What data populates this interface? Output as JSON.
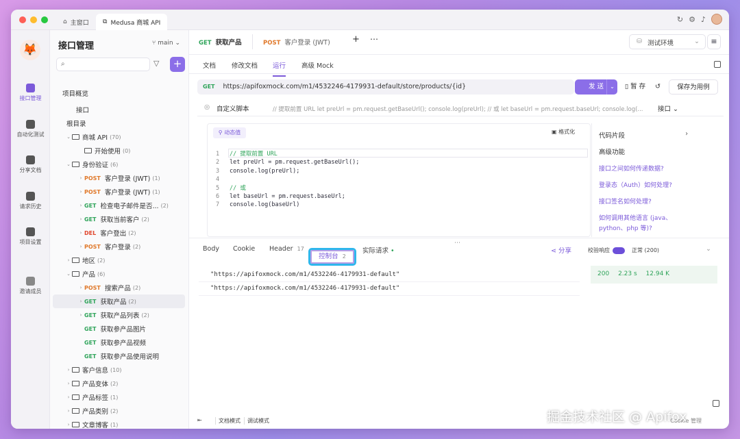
{
  "titlebar": {
    "home_tab": "主窗口",
    "project_tab": "Medusa 商城 API"
  },
  "rail": [
    {
      "label": "接口管理"
    },
    {
      "label": "自动化测试"
    },
    {
      "label": "分享文档"
    },
    {
      "label": "请求历史"
    },
    {
      "label": "项目设置"
    },
    {
      "label": "邀请成员"
    }
  ],
  "tree": {
    "title": "接口管理",
    "branch": "main",
    "items": [
      {
        "label": "项目概览"
      },
      {
        "label": "接口"
      },
      {
        "label": "根目录"
      },
      {
        "label": "商城 API",
        "count": "(70)"
      },
      {
        "label": "开始使用",
        "count": "(0)"
      },
      {
        "label": "身份验证",
        "count": "(6)"
      },
      {
        "method": "POST",
        "label": "客户登录 (JWT)",
        "count": "(1)"
      },
      {
        "method": "POST",
        "label": "客户登录 (JWT)",
        "count": "(1)"
      },
      {
        "method": "GET",
        "label": "检查电子邮件是否...",
        "count": "(2)"
      },
      {
        "method": "GET",
        "label": "获取当前客户",
        "count": "(2)"
      },
      {
        "method": "DEL",
        "label": "客户登出",
        "count": "(2)"
      },
      {
        "method": "POST",
        "label": "客户登录",
        "count": "(2)"
      },
      {
        "label": "地区",
        "count": "(2)"
      },
      {
        "label": "产品",
        "count": "(6)"
      },
      {
        "method": "POST",
        "label": "搜索产品",
        "count": "(2)"
      },
      {
        "method": "GET",
        "label": "获取产品",
        "count": "(2)"
      },
      {
        "method": "GET",
        "label": "获取产品列表",
        "count": "(2)"
      },
      {
        "method": "GET",
        "label": "获取参产品图片",
        "count": ""
      },
      {
        "method": "GET",
        "label": "获取参产品视频",
        "count": ""
      },
      {
        "method": "GET",
        "label": "获取参产品使用说明",
        "count": ""
      },
      {
        "label": "客户信息",
        "count": "(10)"
      },
      {
        "label": "产品变体",
        "count": "(2)"
      },
      {
        "label": "产品标签",
        "count": "(1)"
      },
      {
        "label": "产品类别",
        "count": "(2)"
      },
      {
        "label": "文章博客",
        "count": "(1)"
      }
    ]
  },
  "filetabs": [
    {
      "method": "GET",
      "label": "获取产品"
    },
    {
      "method": "POST",
      "label": "客户登录 (JWT)"
    }
  ],
  "env": "测试环境",
  "subtabs": [
    "文档",
    "修改文档",
    "运行",
    "高级 Mock"
  ],
  "request": {
    "method": "GET",
    "url": "https://apifoxmock.com/m1/4532246-4179931-default/store/products/{id}",
    "send": "发 送",
    "save_temp": "暂 存",
    "save_case": "保存为用例"
  },
  "script": {
    "label": "自定义脚本",
    "hint": "// 提取前置 URL let preUrl = pm.request.getBaseUrl(); console.log(preUrl); // 或 let baseUrl = pm.request.baseUrl; console.log(...",
    "scope": "接口"
  },
  "editor": {
    "dyn": "动态值",
    "fmt": "格式化",
    "lines": [
      {
        "n": "1",
        "t": "// 提取前置 URL"
      },
      {
        "n": "2",
        "t": "let preUrl = pm.request.getBaseUrl();"
      },
      {
        "n": "3",
        "t": "console.log(preUrl);"
      },
      {
        "n": "4",
        "t": ""
      },
      {
        "n": "5",
        "t": "// 或"
      },
      {
        "n": "6",
        "t": "let baseUrl = pm.request.baseUrl;"
      },
      {
        "n": "7",
        "t": "console.log(baseUrl)"
      }
    ]
  },
  "side": {
    "snippets": "代码片段",
    "advanced": "高级功能",
    "links": [
      "接口之间如何传递数据?",
      "登录态（Auth）如何处理?",
      "接口签名如何处理?",
      "如何调用其他语言 (java、python、php 等)?"
    ]
  },
  "resp": {
    "tabs": [
      "Body",
      "Cookie",
      "Header"
    ],
    "header_count": "17",
    "console": "控制台",
    "console_count": "2",
    "actual": "实际请求",
    "share": "分享",
    "verify": "校验响应",
    "status_text": "正常 (200)",
    "logs": [
      "\"https://apifoxmock.com/m1/4532246-4179931-default\"",
      "\"https://apifoxmock.com/m1/4532246-4179931-default\""
    ],
    "stats": {
      "code": "200",
      "time": "2.23 s",
      "size": "12.94 K"
    }
  },
  "bottom": {
    "doc_mode": "文档模式",
    "debug_mode": "调试模式",
    "extra": "Cookie 管理"
  },
  "watermark": "掘金技术社区 @ Apifox"
}
